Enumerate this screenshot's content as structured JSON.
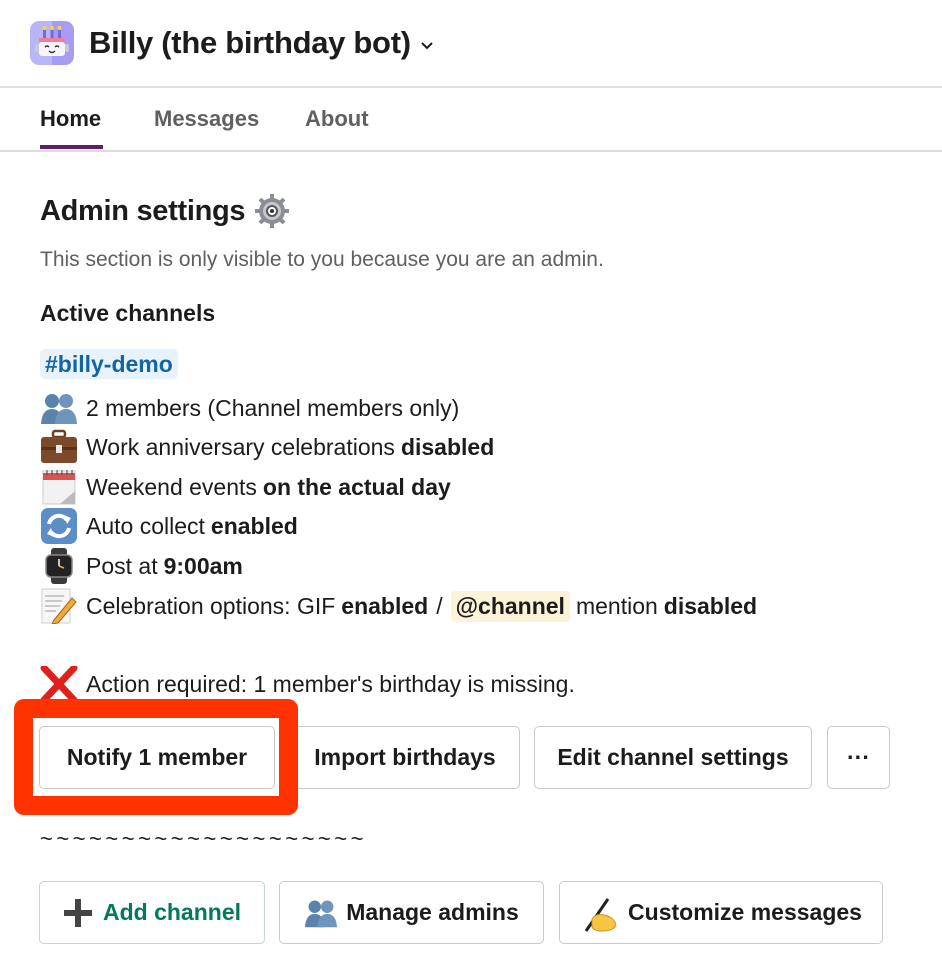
{
  "header": {
    "app_name": "Billy (the birthday bot)",
    "app_icon": "birthday-cake-robot-icon",
    "dropdown_icon": "chevron-down-icon"
  },
  "tabs": [
    {
      "label": "Home",
      "active": true
    },
    {
      "label": "Messages",
      "active": false
    },
    {
      "label": "About",
      "active": false
    }
  ],
  "admin": {
    "title": "Admin settings",
    "title_icon": "gear-icon",
    "subtitle": "This section is only visible to you because you are an admin.",
    "active_channels_label": "Active channels",
    "channel": {
      "name": "#billy-demo",
      "members": {
        "icon": "busts-icon",
        "text": "2 members (Channel members only)"
      },
      "work_anniversary": {
        "icon": "briefcase-icon",
        "text": "Work anniversary celebrations",
        "value": "disabled"
      },
      "weekend": {
        "icon": "calendar-icon",
        "text": "Weekend events",
        "value": "on the actual day"
      },
      "auto_collect": {
        "icon": "arrows-cycle-icon",
        "text": "Auto collect",
        "value": "enabled"
      },
      "post_at": {
        "icon": "watch-icon",
        "text": "Post at",
        "value": "9:00am"
      },
      "celebration": {
        "icon": "memo-pencil-icon",
        "text_prefix": "Celebration options: GIF",
        "gif_value": "enabled",
        "separator": "/",
        "mention": "@channel",
        "mention_text": "mention",
        "mention_value": "disabled"
      }
    },
    "action_required": {
      "icon": "red-x-icon",
      "text": "Action required: 1 member's birthday is missing."
    },
    "channel_buttons": {
      "notify": "Notify 1 member",
      "import": "Import birthdays",
      "edit": "Edit channel settings",
      "more": "···"
    },
    "divider": "~~~~~~~~~~~~~~~~~~~~",
    "footer_buttons": {
      "add_channel": {
        "icon": "plus-icon",
        "label": "Add channel"
      },
      "manage_admins": {
        "icon": "busts-icon",
        "label": "Manage admins"
      },
      "customize": {
        "icon": "writing-hand-icon",
        "label": "Customize messages"
      }
    }
  },
  "colors": {
    "accent_tab": "#611f69",
    "channel_link": "#1264a3",
    "add_channel_green": "#007a5a",
    "highlight_box": "#ff3300"
  }
}
